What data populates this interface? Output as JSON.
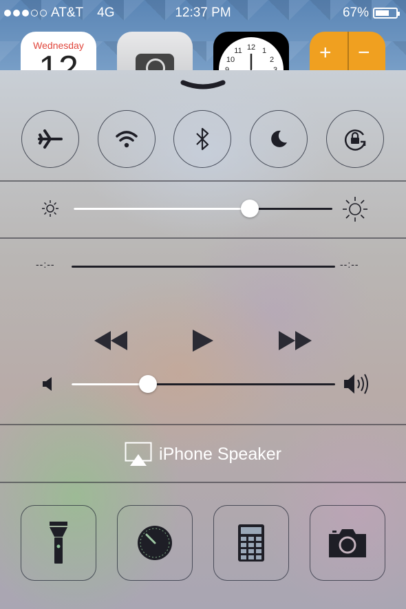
{
  "status_bar": {
    "carrier": "AT&T",
    "network": "4G",
    "time": "12:37 PM",
    "battery_percent": "67%",
    "battery_level": 0.67,
    "signal_bars_filled": 3,
    "signal_bars_total": 5
  },
  "home_screen": {
    "calendar": {
      "weekday": "Wednesday",
      "day": "12"
    },
    "icons": [
      "calendar-app-icon",
      "camera-app-icon",
      "clock-app-icon",
      "calculator-app-icon"
    ]
  },
  "control_center": {
    "toggles": [
      {
        "name": "airplane-mode-toggle",
        "icon": "airplane-icon"
      },
      {
        "name": "wifi-toggle",
        "icon": "wifi-icon"
      },
      {
        "name": "bluetooth-toggle",
        "icon": "bluetooth-icon"
      },
      {
        "name": "do-not-disturb-toggle",
        "icon": "moon-icon"
      },
      {
        "name": "rotation-lock-toggle",
        "icon": "rotation-lock-icon"
      }
    ],
    "brightness_level": 0.68,
    "scrubber": {
      "elapsed": "--:--",
      "remaining": "--:--"
    },
    "volume_level": 0.29,
    "airplay": {
      "label": "iPhone Speaker"
    },
    "shortcuts": [
      {
        "name": "flashlight-button",
        "icon": "flashlight-icon"
      },
      {
        "name": "timer-button",
        "icon": "timer-icon"
      },
      {
        "name": "calculator-button",
        "icon": "calculator-icon"
      },
      {
        "name": "camera-button",
        "icon": "camera-icon"
      }
    ],
    "colors": {
      "ink": "#1e1e26",
      "track_fill": "#ffffff"
    }
  }
}
